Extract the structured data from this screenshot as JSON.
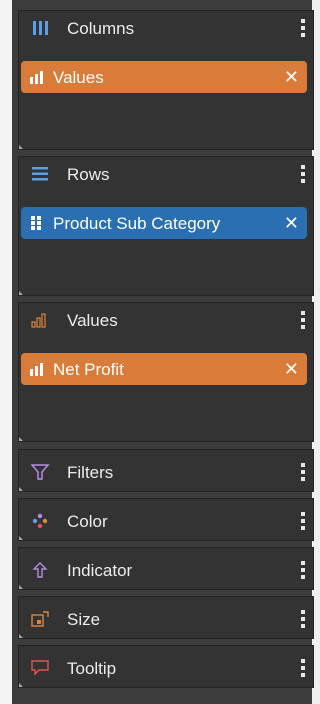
{
  "columns": {
    "title": "Columns",
    "chip": {
      "label": "Values"
    }
  },
  "rows": {
    "title": "Rows",
    "chip": {
      "label": "Product Sub Category"
    }
  },
  "values": {
    "title": "Values",
    "chip": {
      "label": "Net Profit"
    }
  },
  "filters": {
    "title": "Filters"
  },
  "color": {
    "title": "Color"
  },
  "indicator": {
    "title": "Indicator"
  },
  "size": {
    "title": "Size"
  },
  "tooltip": {
    "title": "Tooltip"
  },
  "chip_close_glyph": "✕",
  "colors": {
    "panel_bg": "#3c3c3c",
    "zone_bg": "#333333",
    "accent_orange": "#d97c3a",
    "accent_blue": "#2a6fb2",
    "icon_blue": "#5aa0e6",
    "icon_orange": "#e0863f",
    "icon_purple": "#b48ce6",
    "icon_red": "#e05555"
  }
}
